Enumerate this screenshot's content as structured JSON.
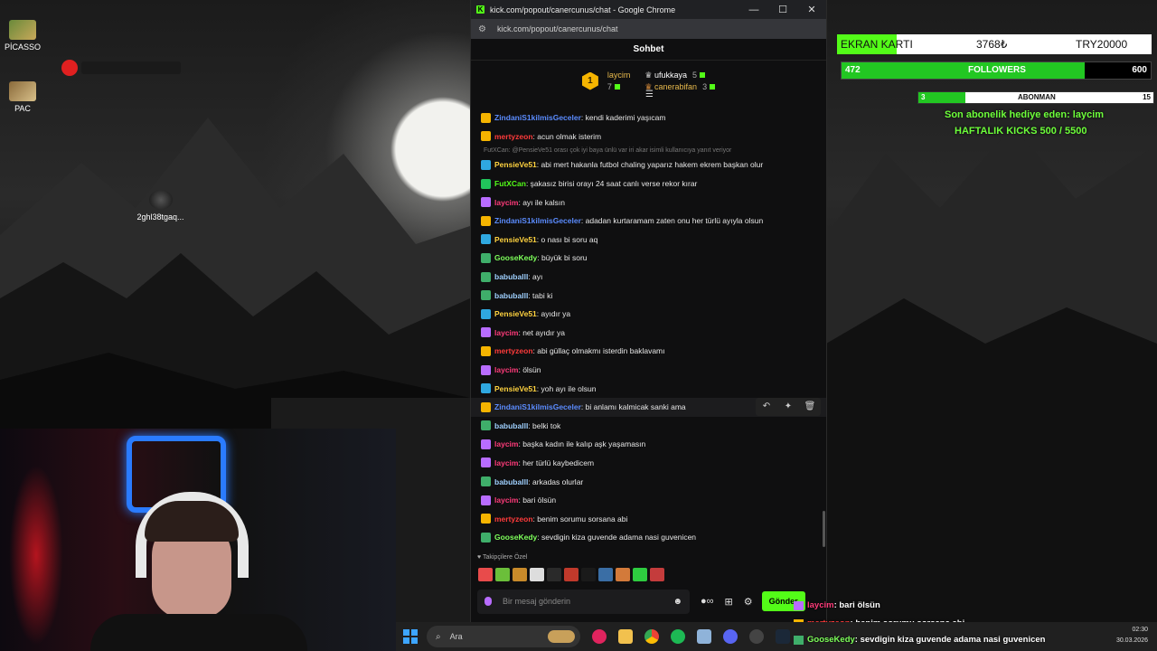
{
  "desktop": {
    "icons": [
      {
        "label": "PİCASSO"
      },
      {
        "label": "PAC"
      },
      {
        "label": "2ghl38tgaq..."
      }
    ]
  },
  "browser": {
    "window_title": "kick.com/popout/canercunus/chat - Google Chrome",
    "url": "kick.com/popout/canercunus/chat",
    "controls": {
      "minimize": "—",
      "maximize": "☐",
      "close": "✕"
    }
  },
  "chat": {
    "title": "Sohbet",
    "leaderboard": {
      "first": {
        "rank": "1",
        "name": "laycim",
        "count": "7"
      },
      "others": [
        {
          "name": "ufukkaya",
          "count": "5"
        },
        {
          "name": "canerabifan",
          "count": "3"
        }
      ]
    },
    "reply_preview": "FutXCan: @PensieVe51 orası çok iyi baya ünlü var iri akar isimli kullanıcıya yanıt veriyor",
    "messages": [
      {
        "user": "ZindaniS1kilmisGeceler",
        "text": ": kendi kaderimi yaşıcam",
        "color": "#5b8cff",
        "badge": "#f5b400"
      },
      {
        "user": "mertyzeon",
        "text": ": acun olmak isterim",
        "color": "#ff3b3b",
        "badge": "#f5b400"
      },
      {
        "user": "PensieVe51",
        "text": ": abi mert hakanla futbol chaling yaparız hakem ekrem başkan olur",
        "color": "#ffd23f",
        "badge": "#2fa8e0"
      },
      {
        "user": "FutXCan",
        "text": ": şakasız birisi orayı 24 saat canlı verse rekor kırar",
        "color": "#53fc18",
        "badge": "#21c45b"
      },
      {
        "user": "laycim",
        "text": ": ayı ile kalsın",
        "color": "#ff3b7a",
        "badge": "#b86cff"
      },
      {
        "user": "ZindaniS1kilmisGeceler",
        "text": ": adadan kurtaramam zaten onu her türlü ayıyla olsun",
        "color": "#5b8cff",
        "badge": "#f5b400"
      },
      {
        "user": "PensieVe51",
        "text": ": o nası bi soru aq",
        "color": "#ffd23f",
        "badge": "#2fa8e0"
      },
      {
        "user": "GooseKedy",
        "text": ": büyük bi soru",
        "color": "#7dff5a",
        "badge": "#3fae6a"
      },
      {
        "user": "babuballl",
        "text": ": ayı",
        "color": "#9fd0ff",
        "badge": "#3fae6a"
      },
      {
        "user": "babuballl",
        "text": ": tabi ki",
        "color": "#9fd0ff",
        "badge": "#3fae6a"
      },
      {
        "user": "PensieVe51",
        "text": ": ayıdır ya",
        "color": "#ffd23f",
        "badge": "#2fa8e0"
      },
      {
        "user": "laycim",
        "text": ": net ayıdır ya",
        "color": "#ff3b7a",
        "badge": "#b86cff"
      },
      {
        "user": "mertyzeon",
        "text": ": abi güllaç olmakmı isterdin baklavamı",
        "color": "#ff3b3b",
        "badge": "#f5b400"
      },
      {
        "user": "laycim",
        "text": ": ölsün",
        "color": "#ff3b7a",
        "badge": "#b86cff"
      },
      {
        "user": "PensieVe51",
        "text": ": yoh ayı ile olsun",
        "color": "#ffd23f",
        "badge": "#2fa8e0"
      },
      {
        "user": "ZindaniS1kilmisGeceler",
        "text": ": bi anlamı kalmicak sanki ama",
        "color": "#5b8cff",
        "badge": "#f5b400"
      },
      {
        "user": "babuballl",
        "text": ": belki tok",
        "color": "#9fd0ff",
        "badge": "#3fae6a"
      },
      {
        "user": "laycim",
        "text": ": başka kadın ile kalıp aşk yaşamasın",
        "color": "#ff3b7a",
        "badge": "#b86cff"
      },
      {
        "user": "laycim",
        "text": ": her türlü kaybedicem",
        "color": "#ff3b7a",
        "badge": "#b86cff"
      },
      {
        "user": "babuballl",
        "text": ": arkadas olurlar",
        "color": "#9fd0ff",
        "badge": "#3fae6a"
      },
      {
        "user": "laycim",
        "text": ": bari ölsün",
        "color": "#ff3b7a",
        "badge": "#b86cff"
      },
      {
        "user": "mertyzeon",
        "text": ": benim sorumu sorsana abi",
        "color": "#ff3b3b",
        "badge": "#f5b400"
      },
      {
        "user": "GooseKedy",
        "text": ": sevdigin kiza guvende adama nasi guvenicen",
        "color": "#7dff5a",
        "badge": "#3fae6a"
      }
    ],
    "hover_actions": [
      "↶",
      "✦",
      "🗑"
    ],
    "emote_section_label": "♥ Takipçilere Özel",
    "input_placeholder": "Bir mesaj gönderin",
    "send_label": "Gönder",
    "emote_colors": [
      "#e84b4b",
      "#6bbf3a",
      "#c88a2a",
      "#ddd",
      "#2a2a2a",
      "#c0392b",
      "#1a1a1a",
      "#3a6ea5",
      "#d37a3a",
      "#2ecc40",
      "#c43c3c"
    ]
  },
  "overlay": {
    "goal": {
      "label": "EKRAN KARTI",
      "amount": "3768₺",
      "target": "TRY20000",
      "progress": 0.19
    },
    "followers": {
      "current": "472",
      "label": "FOLLOWERS",
      "target": "600",
      "progress": 0.787
    },
    "subs": {
      "current": "3",
      "label": "ABONMAN",
      "target": "15",
      "progress": 0.2
    },
    "gift_line": "Son abonelik hediye eden: laycim",
    "kicks_line": "HAFTALIK KICKS 500 / 5500",
    "feed": [
      {
        "user": "laycim",
        "text": ": bari ölsün",
        "color": "#ff3b7a"
      },
      {
        "user": "mertyzeon",
        "text": ": benim sorumu sorsana abi",
        "color": "#ff3b3b"
      },
      {
        "user": "GooseKedy",
        "text": ": sevdigin kiza guvende adama nasi guvenicen",
        "color": "#7dff5a"
      }
    ]
  },
  "taskbar": {
    "search_placeholder": "Ara",
    "time": "02:30",
    "date": "30.03.2026"
  }
}
